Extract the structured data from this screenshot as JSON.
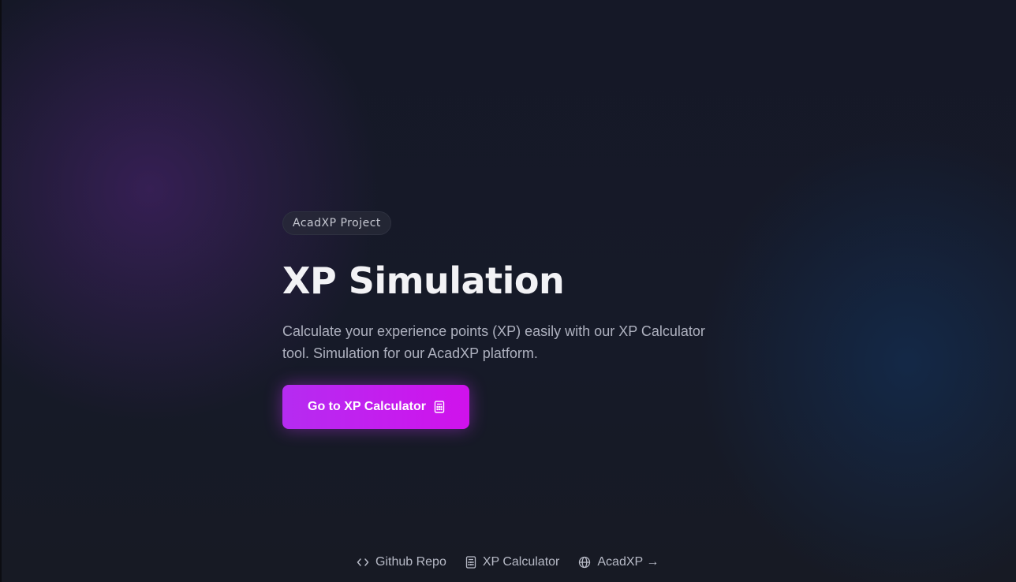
{
  "hero": {
    "badge": "AcadXP Project",
    "title": "XP Simulation",
    "description": "Calculate your experience points (XP) easily with our XP Calculator tool. Simulation for our AcadXP platform.",
    "cta_label": "Go to XP Calculator",
    "cta_icon": "calculator-icon"
  },
  "footer": {
    "links": [
      {
        "label": "Github Repo",
        "icon": "code-icon"
      },
      {
        "label": "XP Calculator",
        "icon": "calculator-icon"
      },
      {
        "label": "AcadXP →",
        "icon": "globe-icon"
      }
    ]
  },
  "colors": {
    "background": "#141724",
    "accent_start": "#b52cf1",
    "accent_end": "#d012ec",
    "text_primary": "#f2f2f5",
    "text_secondary": "#aeb1bf"
  }
}
